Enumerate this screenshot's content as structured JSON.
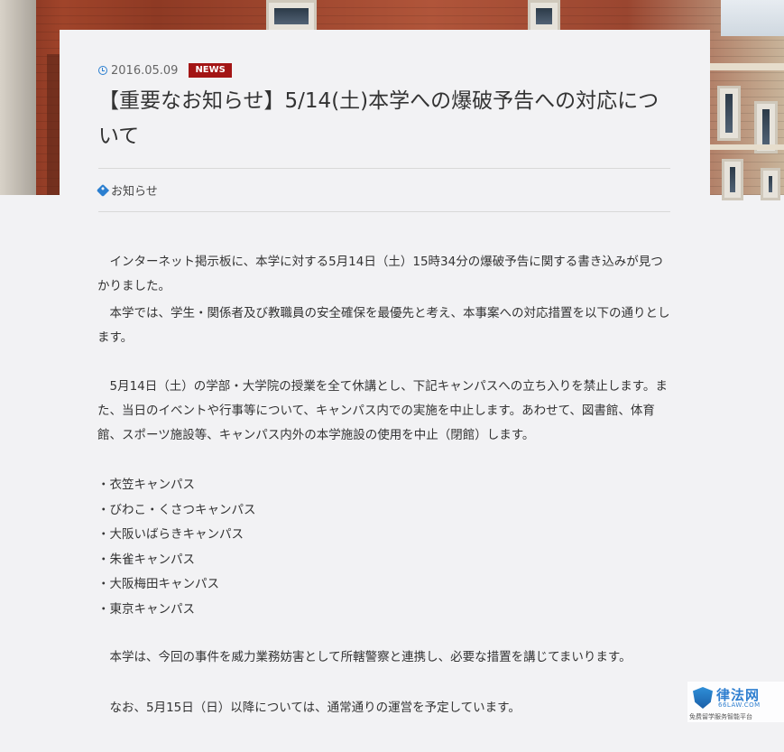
{
  "article": {
    "date": "2016.05.09",
    "badge": "NEWS",
    "title": "【重要なお知らせ】5/14(土)本学への爆破予告への対応について",
    "category": "お知らせ",
    "paragraphs": [
      "　インターネット掲示板に、本学に対する5月14日（土）15時34分の爆破予告に関する書き込みが見つかりました。",
      "　本学では、学生・関係者及び教職員の安全確保を最優先と考え、本事案への対応措置を以下の通りとします。",
      "　5月14日（土）の学部・大学院の授業を全て休講とし、下記キャンパスへの立ち入りを禁止します。また、当日のイベントや行事等について、キャンパス内での実施を中止します。あわせて、図書館、体育館、スポーツ施設等、キャンパス内外の本学施設の使用を中止（閉館）します。",
      "　本学は、今回の事件を威力業務妨害として所轄警察と連携し、必要な措置を講じてまいります。",
      "　なお、5月15日（日）以降については、通常通りの運営を予定しています。"
    ],
    "campuses": [
      "・衣笠キャンパス",
      "・びわこ・くさつキャンパス",
      "・大阪いばらきキャンパス",
      "・朱雀キャンパス",
      "・大阪梅田キャンパス",
      "・東京キャンパス"
    ]
  },
  "watermark": {
    "brand": "律法网",
    "domain": "66LAW.COM",
    "caption": "免费留学服务智能平台"
  },
  "colors": {
    "badge": "#a31515",
    "icon": "#2b7fd0",
    "background": "#f2f2f4"
  }
}
